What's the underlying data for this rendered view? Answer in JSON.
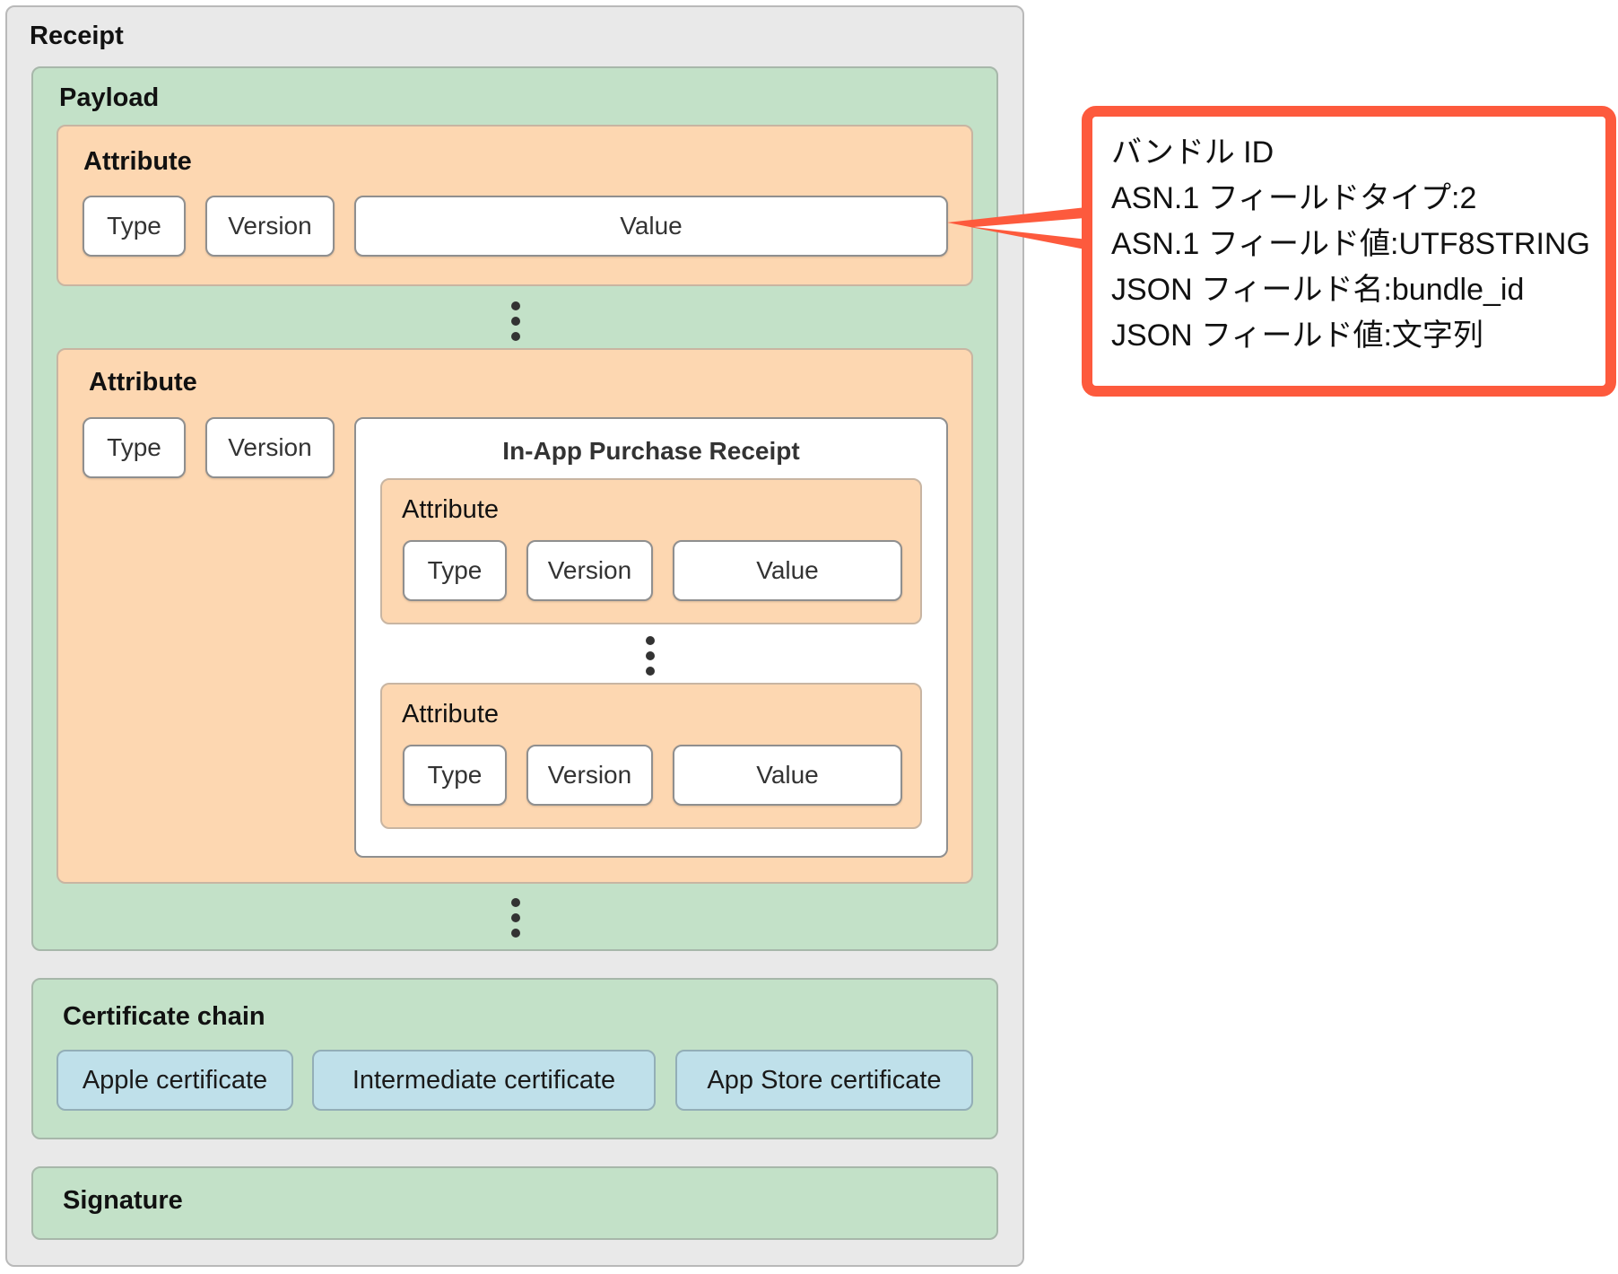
{
  "receipt": {
    "title": "Receipt",
    "payload": {
      "title": "Payload",
      "attribute_top": {
        "title": "Attribute",
        "type": "Type",
        "version": "Version",
        "value": "Value"
      },
      "attribute_bottom": {
        "title": "Attribute",
        "type": "Type",
        "version": "Version",
        "in_app_receipt": {
          "title": "In-App Purchase Receipt",
          "attributes": [
            {
              "title": "Attribute",
              "type": "Type",
              "version": "Version",
              "value": "Value"
            },
            {
              "title": "Attribute",
              "type": "Type",
              "version": "Version",
              "value": "Value"
            }
          ]
        }
      }
    },
    "certificate_chain": {
      "title": "Certificate chain",
      "items": [
        "Apple certificate",
        "Intermediate certificate",
        "App Store certificate"
      ]
    },
    "signature": {
      "title": "Signature"
    }
  },
  "callout": {
    "lines": [
      "バンドル ID",
      "ASN.1 フィールドタイプ:2",
      "ASN.1 フィールド値:UTF8STRING",
      "JSON フィールド名:bundle_id",
      "JSON フィールド値:文字列"
    ],
    "border_color": "#fd5a3d"
  },
  "colors": {
    "receipt_bg": "#e9e9e9",
    "payload_bg": "#c3e1c8",
    "attribute_bg": "#fdd7b1",
    "certificate_bg": "#bfe0ea",
    "callout_border": "#fd5a3d"
  }
}
